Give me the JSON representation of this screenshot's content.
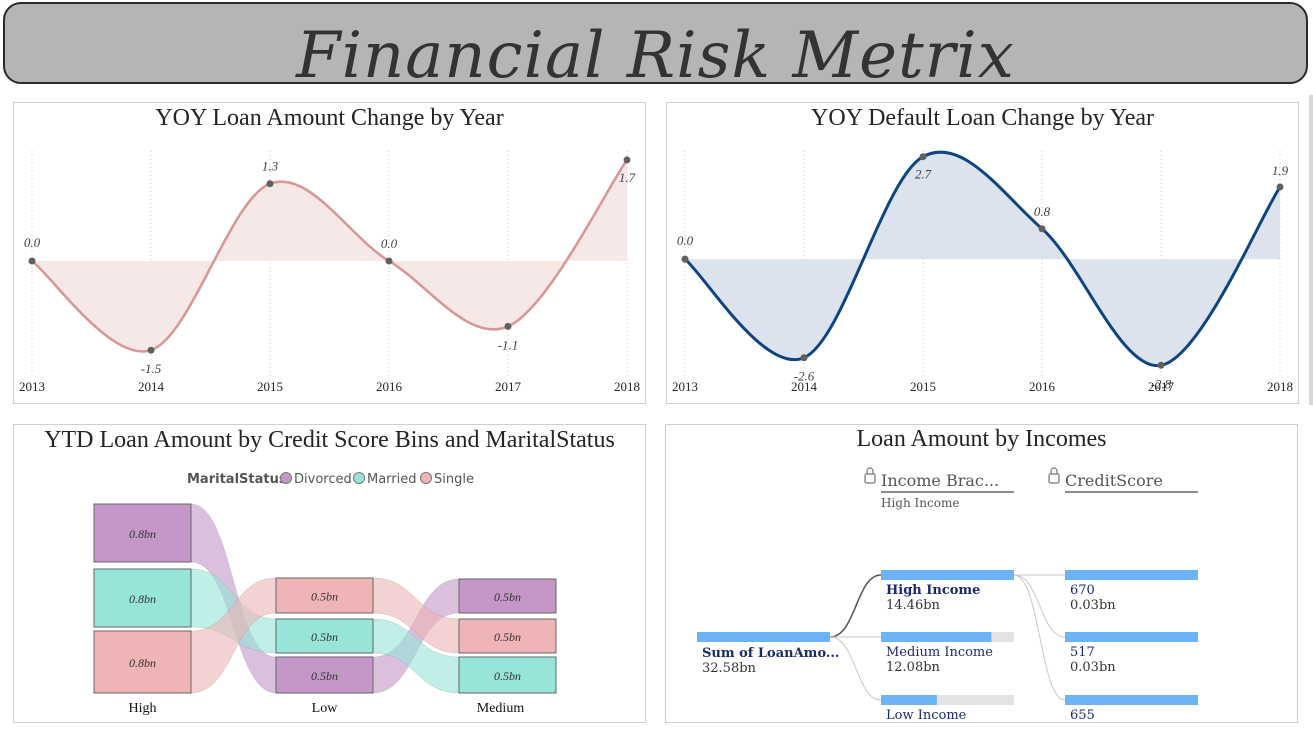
{
  "header": {
    "title": "Financial Risk Metrix"
  },
  "charts": [
    {
      "type": "area",
      "title": "YOY Loan Amount Change by Year",
      "x": [
        "2013",
        "2014",
        "2015",
        "2016",
        "2017",
        "2018"
      ],
      "values": [
        0.0,
        -1.5,
        1.3,
        0.0,
        -1.1,
        1.7
      ],
      "labels": [
        "0.0",
        "-1.5",
        "1.3",
        "0.0",
        "-1.1",
        "1.7"
      ],
      "ylim": [
        -1.85,
        1.85
      ],
      "colors": {
        "line": "#d99898",
        "fill": "#f7e8e8"
      }
    },
    {
      "type": "area",
      "title": "YOY Default Loan Change by Year",
      "x": [
        "2013",
        "2014",
        "2015",
        "2016",
        "2017",
        "2018"
      ],
      "values": [
        0.0,
        -2.6,
        2.7,
        0.8,
        -2.8,
        1.9
      ],
      "labels": [
        "0.0",
        "-2.6",
        "2.7",
        "0.8",
        "-2.8",
        "1.9"
      ],
      "ylim": [
        -2.95,
        2.85
      ],
      "colors": {
        "line": "#0e4580",
        "fill": "#dce3ee"
      }
    },
    {
      "type": "sankey",
      "title": "YTD Loan Amount by Credit Score Bins and MaritalStatus",
      "legend": {
        "title": "MaritalStatus",
        "items": [
          "Divorced",
          "Married",
          "Single"
        ]
      },
      "colors": {
        "Divorced": "#c497c8",
        "Married": "#96e5d8",
        "Single": "#eeb4b6"
      },
      "categories": [
        "High",
        "Low",
        "Medium"
      ],
      "nodes": [
        {
          "category": "High",
          "status": "Divorced",
          "label": "0.8bn"
        },
        {
          "category": "High",
          "status": "Married",
          "label": "0.8bn"
        },
        {
          "category": "High",
          "status": "Single",
          "label": "0.8bn"
        },
        {
          "category": "Low",
          "status": "Single",
          "label": "0.5bn"
        },
        {
          "category": "Low",
          "status": "Married",
          "label": "0.5bn"
        },
        {
          "category": "Low",
          "status": "Divorced",
          "label": "0.5bn"
        },
        {
          "category": "Medium",
          "status": "Divorced",
          "label": "0.5bn"
        },
        {
          "category": "Medium",
          "status": "Single",
          "label": "0.5bn"
        },
        {
          "category": "Medium",
          "status": "Married",
          "label": "0.5bn"
        }
      ]
    },
    {
      "type": "decomposition_tree",
      "title": "Loan Amount by Incomes",
      "levels": [
        {
          "label": "Income Brac...",
          "selected": "High Income"
        },
        {
          "label": "CreditScore",
          "selected": ""
        }
      ],
      "root": {
        "label": "Sum of LoanAmo...",
        "value": "32.58bn",
        "fraction": 1.0
      },
      "branches": [
        {
          "label": "High Income",
          "value": "14.46bn",
          "fraction": 1.0,
          "selected": true
        },
        {
          "label": "Medium Income",
          "value": "12.08bn",
          "fraction": 0.83
        },
        {
          "label": "Low Income",
          "value": "",
          "fraction": 0.42
        }
      ],
      "leaves": [
        {
          "label": "670",
          "value": "0.03bn",
          "fraction": 1.0
        },
        {
          "label": "517",
          "value": "0.03bn",
          "fraction": 1.0
        },
        {
          "label": "655",
          "value": "",
          "fraction": 1.0
        }
      ],
      "colors": {
        "bar": "#6bb3f5",
        "track": "#e3e3e3",
        "selected_text": "#1b2a6b",
        "text": "#1b2a6b"
      }
    }
  ],
  "chart_data": [
    {
      "type": "area",
      "title": "YOY Loan Amount Change by Year",
      "x": [
        "2013",
        "2014",
        "2015",
        "2016",
        "2017",
        "2018"
      ],
      "values": [
        0.0,
        -1.5,
        1.3,
        0.0,
        -1.1,
        1.7
      ]
    },
    {
      "type": "area",
      "title": "YOY Default Loan Change by Year",
      "x": [
        "2013",
        "2014",
        "2015",
        "2016",
        "2017",
        "2018"
      ],
      "values": [
        0.0,
        -2.6,
        2.7,
        0.8,
        -2.8,
        1.9
      ]
    },
    {
      "type": "sankey",
      "title": "YTD Loan Amount by Credit Score Bins and MaritalStatus",
      "categories": [
        "High",
        "Low",
        "Medium"
      ],
      "series": [
        {
          "name": "Divorced",
          "values": [
            "0.8bn",
            "0.5bn",
            "0.5bn"
          ]
        },
        {
          "name": "Married",
          "values": [
            "0.8bn",
            "0.5bn",
            "0.5bn"
          ]
        },
        {
          "name": "Single",
          "values": [
            "0.8bn",
            "0.5bn",
            "0.5bn"
          ]
        }
      ]
    },
    {
      "type": "table",
      "title": "Loan Amount by Incomes",
      "rows": [
        [
          "Sum of LoanAmo...",
          "32.58bn"
        ],
        [
          "High Income",
          "14.46bn"
        ],
        [
          "Medium Income",
          "12.08bn"
        ],
        [
          "Low Income",
          ""
        ],
        [
          "670",
          "0.03bn"
        ],
        [
          "517",
          "0.03bn"
        ],
        [
          "655",
          ""
        ]
      ]
    }
  ]
}
